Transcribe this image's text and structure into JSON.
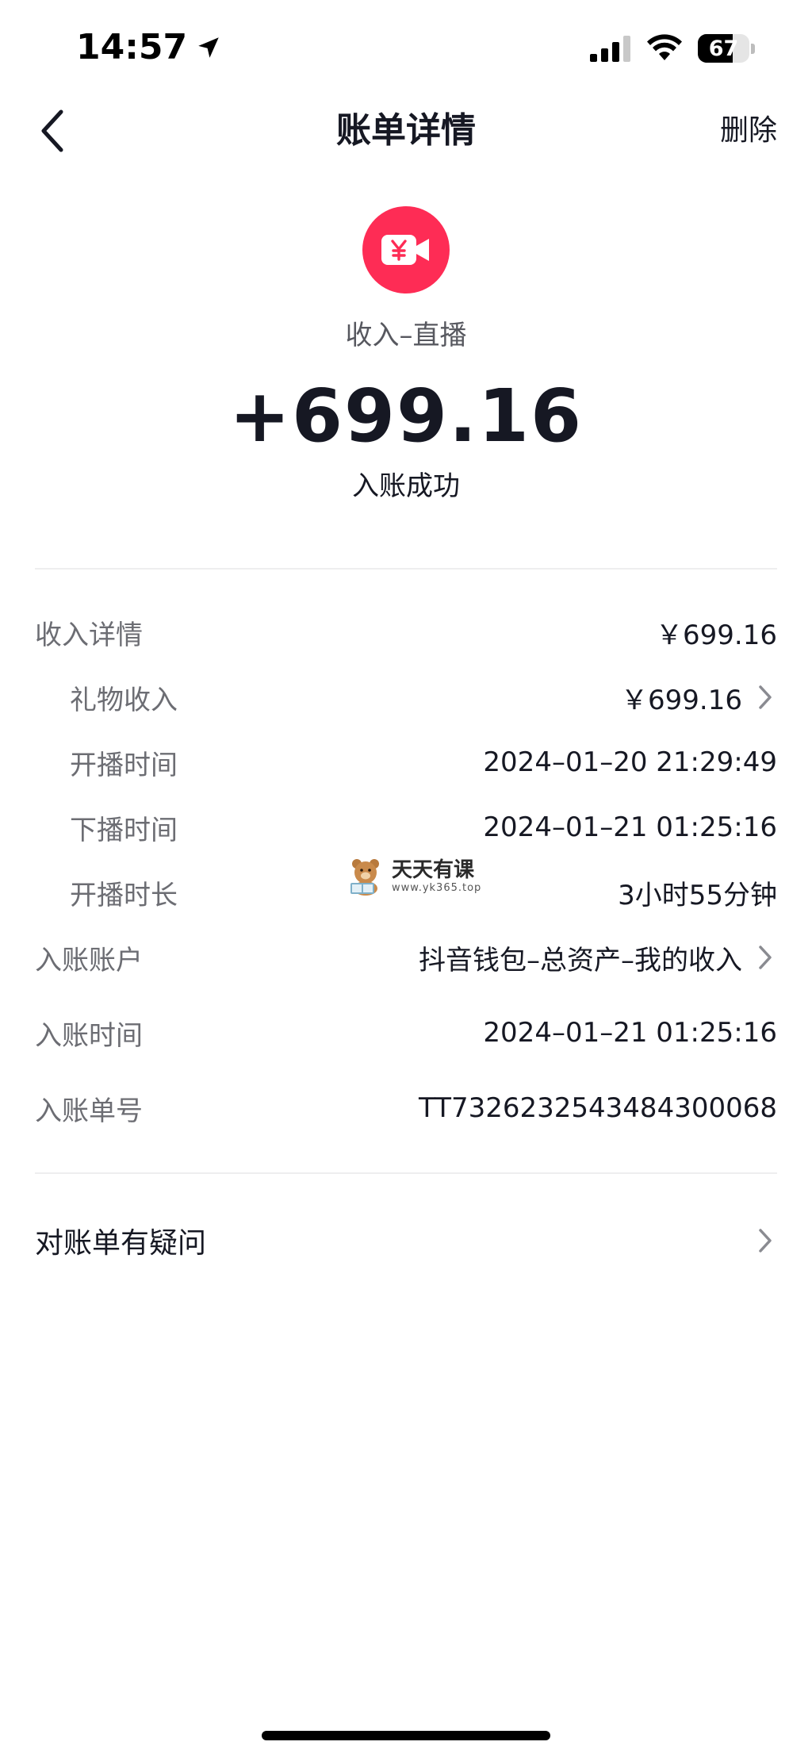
{
  "status_bar": {
    "time": "14:57",
    "battery_percent": "67",
    "battery_level": 0.67
  },
  "nav": {
    "title": "账单详情",
    "delete_label": "删除"
  },
  "header": {
    "category": "收入–直播",
    "amount": "+699.16",
    "status": "入账成功",
    "icon_color": "#fe2c55"
  },
  "details": {
    "income_detail": {
      "label": "收入详情",
      "value": "￥699.16"
    },
    "gift_income": {
      "label": "礼物收入",
      "value": "￥699.16"
    },
    "start_time": {
      "label": "开播时间",
      "value": "2024–01–20 21:29:49"
    },
    "end_time": {
      "label": "下播时间",
      "value": "2024–01–21 01:25:16"
    },
    "duration": {
      "label": "开播时长",
      "value": "3小时55分钟"
    },
    "account": {
      "label": "入账账户",
      "value": "抖音钱包–总资产–我的收入"
    },
    "posting_time": {
      "label": "入账时间",
      "value": "2024–01–21 01:25:16"
    },
    "order_no": {
      "label": "入账单号",
      "value": "TT7326232543484300068"
    }
  },
  "question": {
    "label": "对账单有疑问"
  },
  "watermark": {
    "main": "天天有课",
    "sub": "www.yk365.top"
  }
}
